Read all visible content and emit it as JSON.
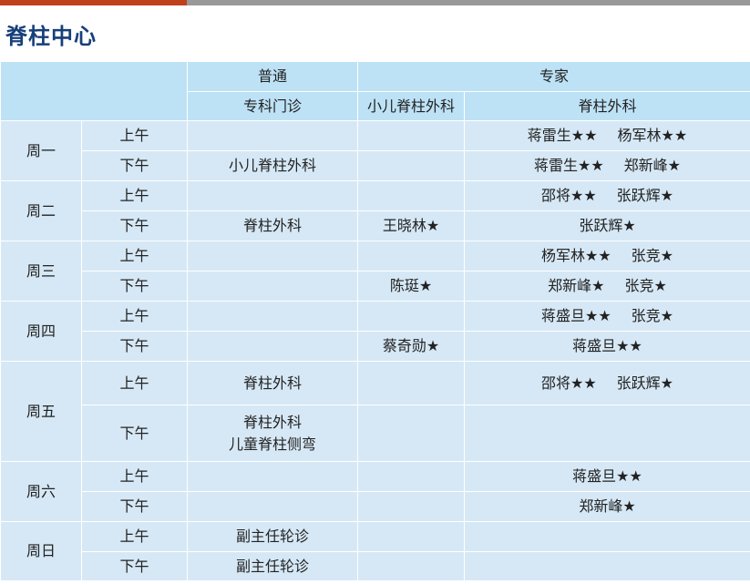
{
  "title": "脊柱中心",
  "header": {
    "putong": "普通",
    "zhuanjia": "专家",
    "zhuanke": "专科门诊",
    "xiaoer": "小儿脊柱外科",
    "jizhu": "脊柱外科"
  },
  "days": [
    {
      "day": "周一",
      "sessions": [
        {
          "period": "上午",
          "general": [],
          "pediatric": "",
          "spine": [
            "蒋雷生★★",
            "杨军林★★"
          ]
        },
        {
          "period": "下午",
          "general": [
            "小儿脊柱外科"
          ],
          "pediatric": "",
          "spine": [
            "蒋雷生★★",
            "郑新峰★"
          ]
        }
      ]
    },
    {
      "day": "周二",
      "sessions": [
        {
          "period": "上午",
          "general": [],
          "pediatric": "",
          "spine": [
            "邵将★★",
            "张跃辉★"
          ]
        },
        {
          "period": "下午",
          "general": [
            "脊柱外科"
          ],
          "pediatric": "王晓林★",
          "spine": [
            "张跃辉★"
          ]
        }
      ]
    },
    {
      "day": "周三",
      "sessions": [
        {
          "period": "上午",
          "general": [],
          "pediatric": "",
          "spine": [
            "杨军林★★",
            "张竞★"
          ]
        },
        {
          "period": "下午",
          "general": [],
          "pediatric": "陈珽★",
          "spine": [
            "郑新峰★",
            "张竞★"
          ]
        }
      ]
    },
    {
      "day": "周四",
      "sessions": [
        {
          "period": "上午",
          "general": [],
          "pediatric": "",
          "spine": [
            "蒋盛旦★★",
            "张竞★"
          ]
        },
        {
          "period": "下午",
          "general": [],
          "pediatric": "蔡奇勋★",
          "spine": [
            "蒋盛旦★★"
          ]
        }
      ]
    },
    {
      "day": "周五",
      "sessions": [
        {
          "period": "上午",
          "general": [
            "脊柱外科"
          ],
          "pediatric": "",
          "spine": [
            "邵将★★",
            "张跃辉★"
          ]
        },
        {
          "period": "下午",
          "general": [
            "脊柱外科",
            "儿童脊柱侧弯"
          ],
          "pediatric": "",
          "spine": []
        }
      ]
    },
    {
      "day": "周六",
      "sessions": [
        {
          "period": "上午",
          "general": [],
          "pediatric": "",
          "spine": [
            "蒋盛旦★★"
          ]
        },
        {
          "period": "下午",
          "general": [],
          "pediatric": "",
          "spine": [
            "郑新峰★"
          ]
        }
      ]
    },
    {
      "day": "周日",
      "sessions": [
        {
          "period": "上午",
          "general": [
            "副主任轮诊"
          ],
          "pediatric": "",
          "spine": []
        },
        {
          "period": "下午",
          "general": [
            "副主任轮诊"
          ],
          "pediatric": "",
          "spine": []
        }
      ]
    }
  ]
}
